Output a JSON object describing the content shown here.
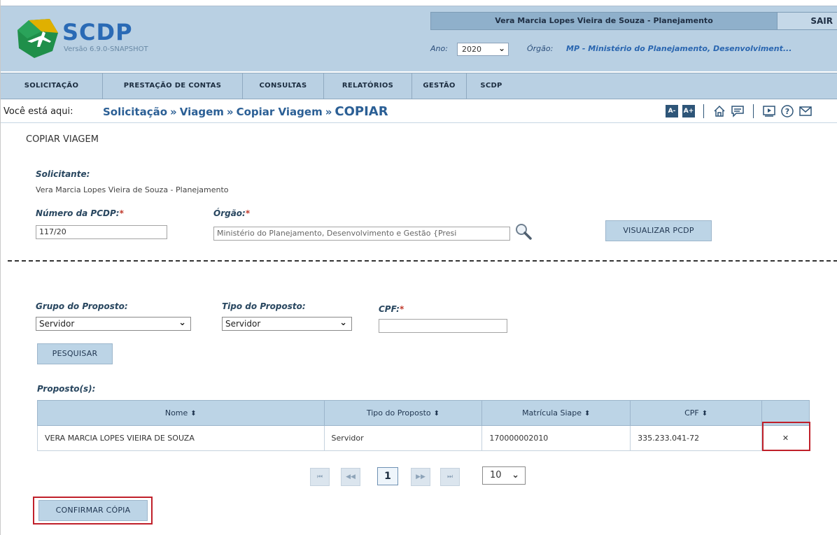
{
  "app": {
    "logo_text": "SCDP",
    "version": "Versão 6.9.0-SNAPSHOT",
    "user": "Vera Marcia Lopes Vieira de Souza - Planejamento",
    "logout": "SAIR",
    "ano_label": "Ano:",
    "ano_value": "2020",
    "orgao_label": "Órgão:",
    "orgao_value": "MP - Ministério do Planejamento, Desenvolviment..."
  },
  "nav": {
    "items": [
      "SOLICITAÇÃO",
      "PRESTAÇÃO DE CONTAS",
      "CONSULTAS",
      "RELATÓRIOS",
      "GESTÃO",
      "SCDP"
    ]
  },
  "breadcrumb": {
    "prefix": "Você está aqui:",
    "items": [
      "Solicitação",
      "Viagem",
      "Copiar Viagem",
      "COPIAR"
    ],
    "separator": "»"
  },
  "toolbar": {
    "font_decrease": "A-",
    "font_increase": "A+"
  },
  "form": {
    "title": "COPIAR VIAGEM",
    "solicitante_label": "Solicitante:",
    "solicitante_value": "Vera Marcia Lopes Vieira de Souza - Planejamento",
    "numero_label": "Número da PCDP:",
    "numero_value": "117/20",
    "orgao_label": "Órgão:",
    "orgao_value": "Ministério do Planejamento, Desenvolvimento e Gestão {Presi",
    "visualizar_button": "VISUALIZAR PCDP",
    "required_mark": "*"
  },
  "search": {
    "grupo_label": "Grupo do Proposto:",
    "grupo_value": "Servidor",
    "tipo_label": "Tipo do Proposto:",
    "tipo_value": "Servidor",
    "cpf_label": "CPF:",
    "cpf_value": "",
    "search_button": "PESQUISAR"
  },
  "proposto": {
    "label": "Proposto(s):",
    "columns": [
      "Nome",
      "Tipo do Proposto",
      "Matrícula Siape",
      "CPF"
    ],
    "rows": [
      {
        "nome": "VERA MARCIA LOPES VIEIRA DE SOUZA",
        "tipo": "Servidor",
        "matricula": "170000002010",
        "cpf": "335.233.041-72",
        "delete": "✕"
      }
    ]
  },
  "pager": {
    "first": "⏮",
    "prev": "◀◀",
    "current": "1",
    "next": "▶▶",
    "last": "⏭",
    "page_size": "10"
  },
  "footer": {
    "confirm_button": "CONFIRMAR CÓPIA"
  },
  "colors": {
    "header_bg": "#b9d0e3",
    "accent": "#2b5f95",
    "highlight": "#c0202a"
  }
}
